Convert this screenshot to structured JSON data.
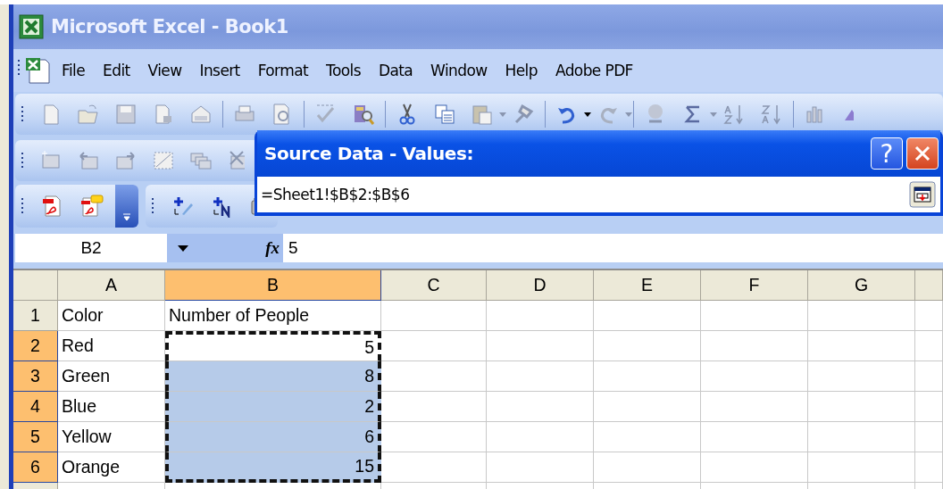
{
  "window": {
    "title": "Microsoft Excel - Book1"
  },
  "menu": [
    "File",
    "Edit",
    "View",
    "Insert",
    "Format",
    "Tools",
    "Data",
    "Window",
    "Help",
    "Adobe PDF"
  ],
  "formula_bar": {
    "name_box": "B2",
    "fx": "fx",
    "value": "5"
  },
  "dialog": {
    "title": "Source Data - Values:",
    "help": "?",
    "value": "=Sheet1!$B$2:$B$6"
  },
  "sheet": {
    "columns": [
      {
        "label": "A",
        "selected": false
      },
      {
        "label": "B",
        "selected": true
      },
      {
        "label": "C",
        "selected": false
      },
      {
        "label": "D",
        "selected": false
      },
      {
        "label": "E",
        "selected": false
      },
      {
        "label": "F",
        "selected": false
      },
      {
        "label": "G",
        "selected": false
      }
    ],
    "rows": [
      {
        "number": "1",
        "selected": false,
        "cells": [
          {
            "text": "Color",
            "highlighted": false,
            "in_marquee": false
          },
          {
            "text": "Number of People",
            "highlighted": false,
            "in_marquee": false
          }
        ]
      },
      {
        "number": "2",
        "selected": true,
        "cells": [
          {
            "text": "Red",
            "highlighted": false,
            "in_marquee": false
          },
          {
            "text": "5",
            "highlighted": false,
            "in_marquee": true
          }
        ]
      },
      {
        "number": "3",
        "selected": true,
        "cells": [
          {
            "text": "Green",
            "highlighted": false,
            "in_marquee": false
          },
          {
            "text": "8",
            "highlighted": true,
            "in_marquee": true
          }
        ]
      },
      {
        "number": "4",
        "selected": true,
        "cells": [
          {
            "text": "Blue",
            "highlighted": false,
            "in_marquee": false
          },
          {
            "text": "2",
            "highlighted": true,
            "in_marquee": true
          }
        ]
      },
      {
        "number": "5",
        "selected": true,
        "cells": [
          {
            "text": "Yellow",
            "highlighted": false,
            "in_marquee": false
          },
          {
            "text": "6",
            "highlighted": true,
            "in_marquee": true
          }
        ]
      },
      {
        "number": "6",
        "selected": true,
        "cells": [
          {
            "text": "Orange",
            "highlighted": false,
            "in_marquee": false
          },
          {
            "text": "15",
            "highlighted": true,
            "in_marquee": true
          }
        ]
      }
    ]
  }
}
